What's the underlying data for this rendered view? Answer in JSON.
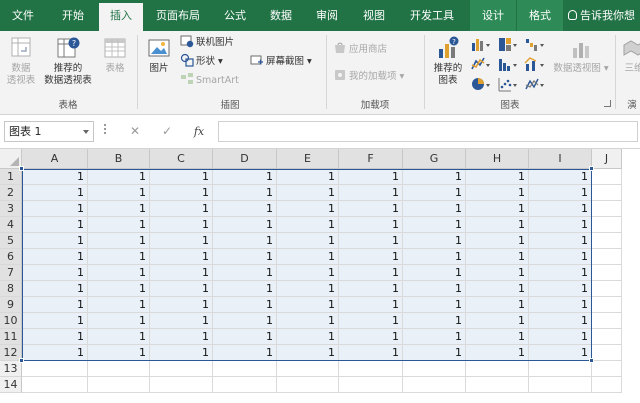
{
  "tabs": [
    {
      "label": "文件",
      "active": false
    },
    {
      "label": "开始",
      "active": false
    },
    {
      "label": "插入",
      "active": true
    },
    {
      "label": "页面布局",
      "active": false
    },
    {
      "label": "公式",
      "active": false
    },
    {
      "label": "数据",
      "active": false
    },
    {
      "label": "审阅",
      "active": false
    },
    {
      "label": "视图",
      "active": false
    },
    {
      "label": "开发工具",
      "active": false
    },
    {
      "label": "设计",
      "active": false,
      "contextual": true
    },
    {
      "label": "格式",
      "active": false,
      "contextual": true
    }
  ],
  "tell_me": "告诉我你想",
  "ribbon": {
    "tables": {
      "label": "表格",
      "pivot_line1": "数据",
      "pivot_line2": "透视表",
      "recommended_line1": "推荐的",
      "recommended_line2": "数据透视表",
      "table": "表格"
    },
    "illustrations": {
      "label": "插图",
      "pictures": "图片",
      "online_pictures": "联机图片",
      "shapes": "形状",
      "smartart": "SmartArt",
      "screenshot": "屏幕截图"
    },
    "addins": {
      "label": "加载项",
      "store": "应用商店",
      "my_addins": "我的加载项"
    },
    "charts": {
      "label": "图表",
      "recommended_line1": "推荐的",
      "recommended_line2": "图表",
      "pivotchart": "数据透视图"
    },
    "tours": {
      "label_partial": "演",
      "map_partial": "三维"
    }
  },
  "formula_bar": {
    "name_box": "图表 1",
    "cancel": "✕",
    "enter": "✓",
    "fx": "fx",
    "value": ""
  },
  "sheet": {
    "columns": [
      "A",
      "B",
      "C",
      "D",
      "E",
      "F",
      "G",
      "H",
      "I",
      "J"
    ],
    "rows": [
      {
        "num": "1",
        "cells": [
          "1",
          "1",
          "1",
          "1",
          "1",
          "1",
          "1",
          "1",
          "1"
        ]
      },
      {
        "num": "2",
        "cells": [
          "1",
          "1",
          "1",
          "1",
          "1",
          "1",
          "1",
          "1",
          "1"
        ]
      },
      {
        "num": "3",
        "cells": [
          "1",
          "1",
          "1",
          "1",
          "1",
          "1",
          "1",
          "1",
          "1"
        ]
      },
      {
        "num": "4",
        "cells": [
          "1",
          "1",
          "1",
          "1",
          "1",
          "1",
          "1",
          "1",
          "1"
        ]
      },
      {
        "num": "5",
        "cells": [
          "1",
          "1",
          "1",
          "1",
          "1",
          "1",
          "1",
          "1",
          "1"
        ]
      },
      {
        "num": "6",
        "cells": [
          "1",
          "1",
          "1",
          "1",
          "1",
          "1",
          "1",
          "1",
          "1"
        ]
      },
      {
        "num": "7",
        "cells": [
          "1",
          "1",
          "1",
          "1",
          "1",
          "1",
          "1",
          "1",
          "1"
        ]
      },
      {
        "num": "8",
        "cells": [
          "1",
          "1",
          "1",
          "1",
          "1",
          "1",
          "1",
          "1",
          "1"
        ]
      },
      {
        "num": "9",
        "cells": [
          "1",
          "1",
          "1",
          "1",
          "1",
          "1",
          "1",
          "1",
          "1"
        ]
      },
      {
        "num": "10",
        "cells": [
          "1",
          "1",
          "1",
          "1",
          "1",
          "1",
          "1",
          "1",
          "1"
        ]
      },
      {
        "num": "11",
        "cells": [
          "1",
          "1",
          "1",
          "1",
          "1",
          "1",
          "1",
          "1",
          "1"
        ]
      },
      {
        "num": "12",
        "cells": [
          "1",
          "1",
          "1",
          "1",
          "1",
          "1",
          "1",
          "1",
          "1"
        ]
      },
      {
        "num": "13",
        "cells": []
      },
      {
        "num": "14",
        "cells": []
      }
    ],
    "selection": "A1:I12"
  },
  "colors": {
    "accent": "#217346",
    "selection_border": "#2b5797",
    "selection_fill": "#eaf0f8"
  }
}
